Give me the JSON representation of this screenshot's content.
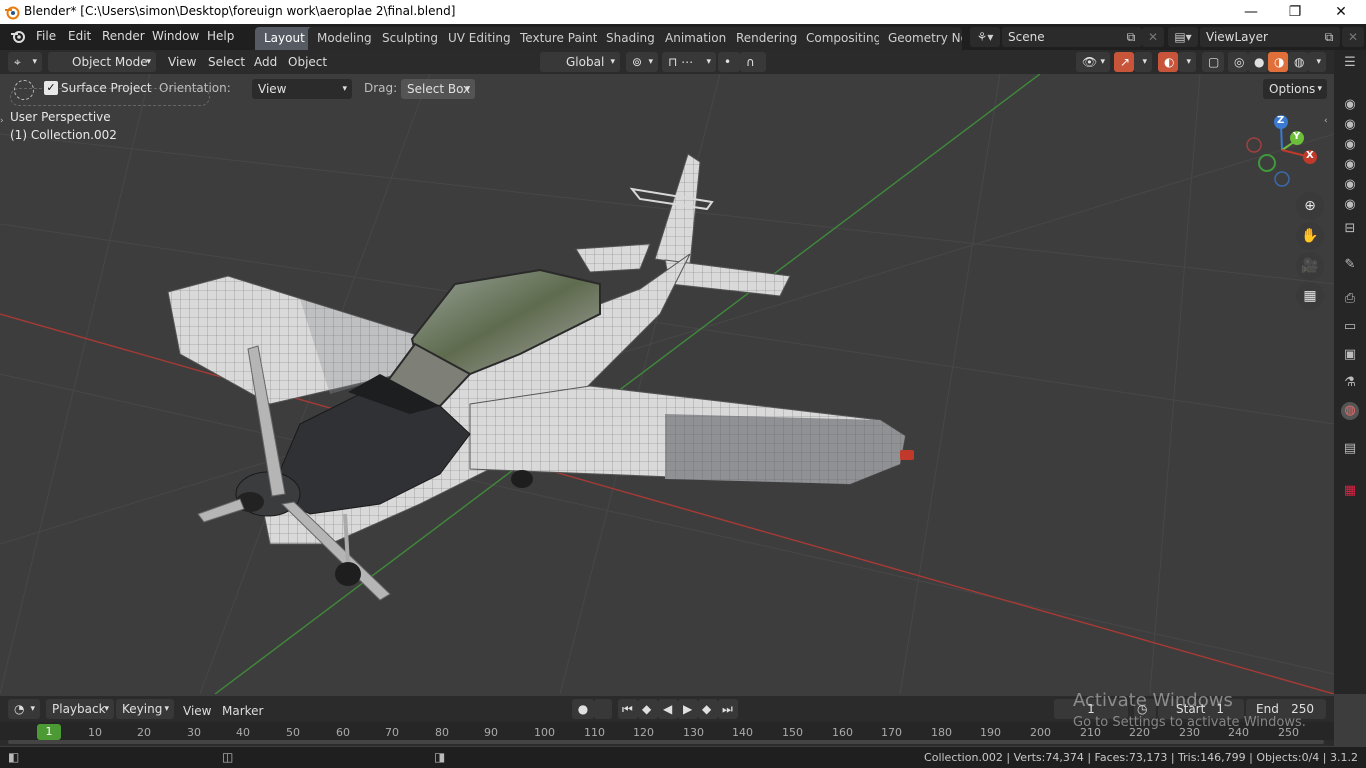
{
  "title_bar": {
    "title": "Blender* [C:\\Users\\simon\\Desktop\\foreuign work\\aeroplae 2\\final.blend]",
    "minimize": "—",
    "maximize": "❐",
    "close": "✕"
  },
  "menu": [
    "File",
    "Edit",
    "Render",
    "Window",
    "Help"
  ],
  "workspaces": [
    "Layout",
    "Modeling",
    "Sculpting",
    "UV Editing",
    "Texture Paint",
    "Shading",
    "Animation",
    "Rendering",
    "Compositing",
    "Geometry Nod"
  ],
  "active_workspace": "Layout",
  "scene": {
    "label": "Scene"
  },
  "view_layer": {
    "label": "ViewLayer"
  },
  "header3d": {
    "mode": "Object Mode",
    "menus": [
      "View",
      "Select",
      "Add",
      "Object"
    ],
    "transform": "Global"
  },
  "tool_settings": {
    "surface_project_label": "Surface Project",
    "surface_project_checked": true,
    "orientation_label": "Orientation:",
    "orientation_value": "View",
    "drag_label": "Drag:",
    "drag_value": "Select Box",
    "options_label": "Options"
  },
  "viewport": {
    "perspective": "User Perspective",
    "collection": "(1) Collection.002"
  },
  "gizmo": {
    "x": "X",
    "y": "Y",
    "z": "Z"
  },
  "timeline": {
    "playback": "Playback",
    "keying": "Keying",
    "view": "View",
    "marker": "Marker",
    "current_frame": "1",
    "start_label": "Start",
    "start_value": "1",
    "end_label": "End",
    "end_value": "250",
    "ticks": [
      "1",
      "10",
      "20",
      "30",
      "40",
      "50",
      "60",
      "70",
      "80",
      "90",
      "100",
      "110",
      "120",
      "130",
      "140",
      "150",
      "160",
      "170",
      "180",
      "190",
      "200",
      "210",
      "220",
      "230",
      "240",
      "250"
    ]
  },
  "watermark": {
    "line1": "Activate Windows",
    "line2": "Go to Settings to activate Windows."
  },
  "status": "Collection.002 | Verts:74,374 | Faces:73,173 | Tris:146,799 | Objects:0/4 | 3.1.2",
  "colors": {
    "accent": "#4772b3",
    "active_tab": "#555a63",
    "x_axis": "#c0392b",
    "y_axis": "#6bbf3a",
    "z_axis": "#3a7ad0"
  }
}
